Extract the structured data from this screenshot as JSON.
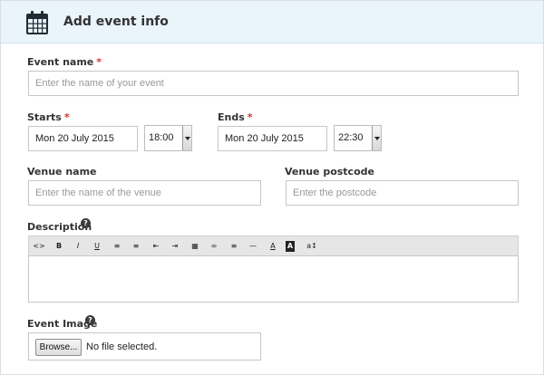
{
  "header": {
    "title": "Add event info",
    "icon": "calendar-icon"
  },
  "event_name": {
    "label": "Event name",
    "required_mark": "*",
    "placeholder": "Enter the name of your event"
  },
  "starts": {
    "label": "Starts",
    "required_mark": "*",
    "date": "Mon 20 July 2015",
    "time": "18:00"
  },
  "ends": {
    "label": "Ends",
    "required_mark": "*",
    "date": "Mon 20 July 2015",
    "time": "22:30"
  },
  "venue_name": {
    "label": "Venue name",
    "placeholder": "Enter the name of the venue"
  },
  "venue_postcode": {
    "label": "Venue postcode",
    "placeholder": "Enter the postcode"
  },
  "description": {
    "label": "Description",
    "help": "?",
    "toolbar": [
      {
        "name": "html-source-icon",
        "glyph": "<>"
      },
      {
        "name": "bold-icon",
        "glyph": "B"
      },
      {
        "name": "italic-icon",
        "glyph": "I"
      },
      {
        "name": "underline-icon",
        "glyph": "U"
      },
      {
        "name": "unordered-list-icon",
        "glyph": "≡"
      },
      {
        "name": "ordered-list-icon",
        "glyph": "≡"
      },
      {
        "name": "outdent-icon",
        "glyph": "⇤"
      },
      {
        "name": "indent-icon",
        "glyph": "⇥"
      },
      {
        "name": "image-icon",
        "glyph": "▦"
      },
      {
        "name": "link-icon",
        "glyph": "∞"
      },
      {
        "name": "align-icon",
        "glyph": "≡"
      },
      {
        "name": "horizontal-rule-icon",
        "glyph": "—"
      },
      {
        "name": "font-color-icon",
        "glyph": "A"
      },
      {
        "name": "background-color-icon",
        "glyph": "A"
      },
      {
        "name": "font-size-icon",
        "glyph": "a↕"
      }
    ]
  },
  "event_image": {
    "label": "Event Image",
    "help": "?",
    "browse_label": "Browse...",
    "status": "No file selected."
  },
  "colors": {
    "header_bg": "#e9f4fb",
    "required": "#e0302a"
  }
}
